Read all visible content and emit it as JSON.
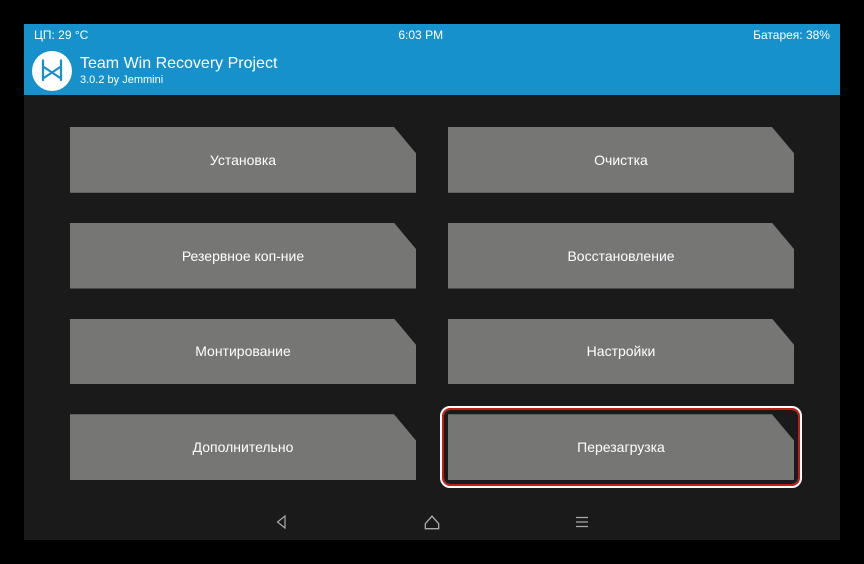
{
  "status": {
    "cpu_temp": "ЦП: 29 °C",
    "time": "6:03 PM",
    "battery": "Батарея: 38%"
  },
  "header": {
    "title": "Team Win Recovery Project",
    "subtitle": "3.0.2 by Jemmini"
  },
  "buttons": {
    "install": "Установка",
    "wipe": "Очистка",
    "backup": "Резервное коп-ние",
    "restore": "Восстановление",
    "mount": "Монтирование",
    "settings": "Настройки",
    "advanced": "Дополнительно",
    "reboot": "Перезагрузка"
  }
}
